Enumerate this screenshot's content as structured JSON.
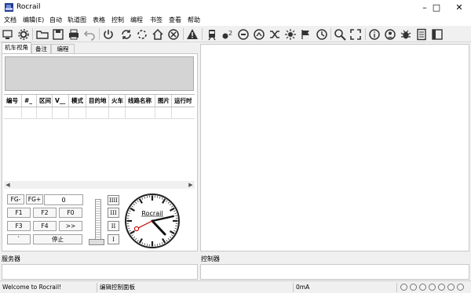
{
  "window": {
    "title": "Rocrail"
  },
  "menu": [
    "文档",
    "编辑(E)",
    "自动",
    "轨道图",
    "表格",
    "控制",
    "编程",
    "书签",
    "查看",
    "帮助"
  ],
  "toolbar": {
    "icons": [
      "system-info-icon",
      "settings-icon",
      "open-folder-icon",
      "save-icon",
      "print-icon",
      "undo-icon",
      "power-icon",
      "connect-icon",
      "disconnect-icon",
      "home-icon",
      "emergency-stop-icon",
      "warning-icon",
      "train-icon",
      "loco-number-icon",
      "speed-gauge-icon",
      "turnout-icon",
      "shuffle-icon",
      "light-icon",
      "flags-icon",
      "clock-icon",
      "zoom-icon",
      "fullscreen-icon",
      "info-icon",
      "user-icon",
      "bug-icon",
      "document-icon",
      "sidebar-icon"
    ]
  },
  "tabs": [
    "机车视角",
    "备注",
    "编程"
  ],
  "loco_table": {
    "columns": [
      "编号",
      "#_",
      "区间",
      "V__",
      "模式",
      "目的地",
      "火车",
      "线路名称",
      "图片",
      "运行时"
    ]
  },
  "throttle": {
    "fg_minus": "FG-",
    "fg_plus": "FG+",
    "speed": "0",
    "f1": "F1",
    "f2": "F2",
    "f0": "F0",
    "f3": "F3",
    "f4": "F4",
    "more": ">>",
    "direction": "`",
    "stop": "停止",
    "gears": [
      "IIII",
      "III",
      "II",
      "I"
    ],
    "clock_brand": "Rocrail"
  },
  "panels": {
    "server": "服务器",
    "controller": "控制器"
  },
  "status": {
    "message": "Welcome to Rocrail!",
    "panel": "编辑控制面板",
    "current": "0mA",
    "leds": 7
  },
  "colors": {
    "accent": "#c00000",
    "panel_bg": "#f0f0f0"
  }
}
